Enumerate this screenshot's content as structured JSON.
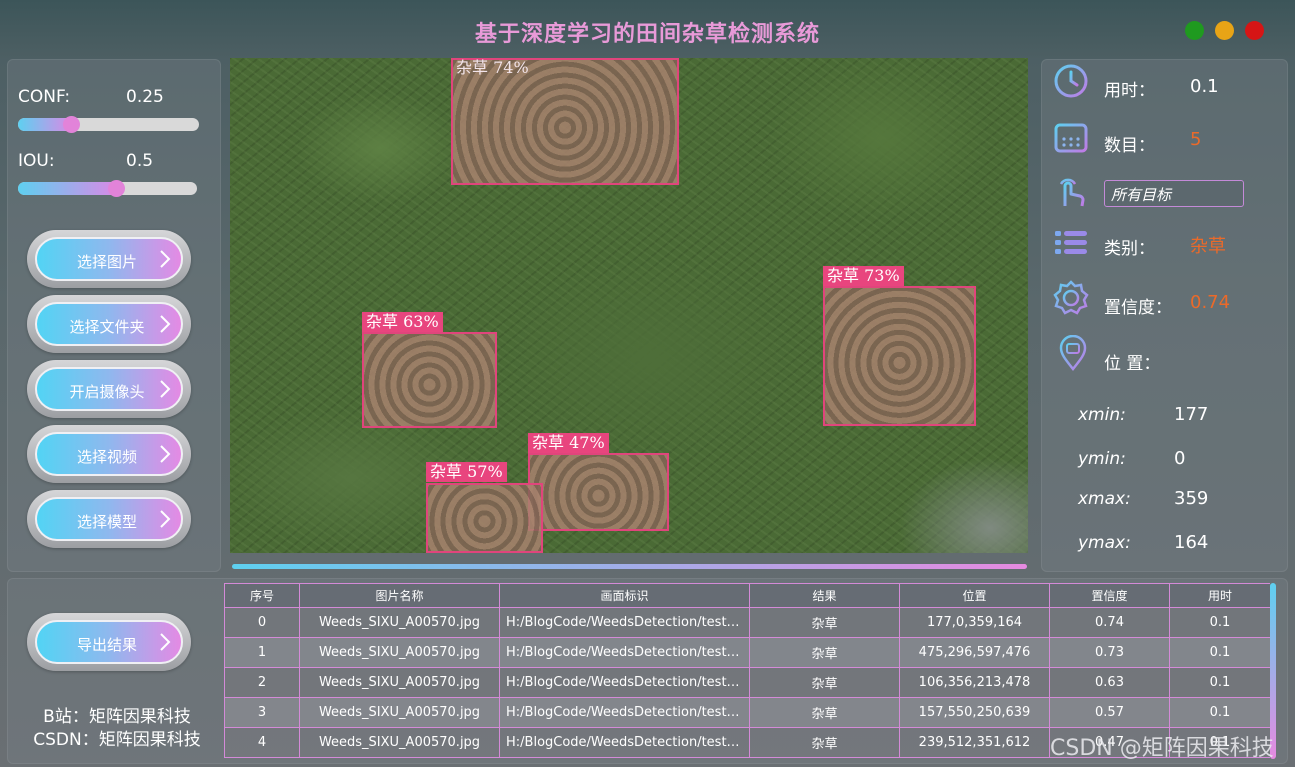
{
  "window": {
    "title": "基于深度学习的田间杂草检测系统"
  },
  "params": {
    "conf_label": "CONF:",
    "conf_value": "0.25",
    "conf_level": 0.25,
    "iou_label": "IOU:",
    "iou_value": "0.5",
    "iou_level": 0.5
  },
  "buttons": {
    "select_image": "选择图片",
    "select_folder": "选择文件夹",
    "open_camera": "开启摄像头",
    "select_video": "选择视频",
    "select_model": "选择模型",
    "export": "导出结果"
  },
  "credits": {
    "bilibili": "B站：矩阵因果科技",
    "csdn": "CSDN：矩阵因果科技"
  },
  "detections": [
    {
      "label": "杂草  74%"
    },
    {
      "label": "杂草  73%"
    },
    {
      "label": "杂草  63%"
    },
    {
      "label": "杂草  47%"
    },
    {
      "label": "杂草  57%"
    }
  ],
  "info": {
    "time_label": "用时：",
    "time_value": "0.1",
    "count_label": "数目：",
    "count_value": "5",
    "target_select": "所有目标",
    "class_label": "类别：",
    "class_value": "杂草",
    "conf_label": "置信度：",
    "conf_value": "0.74",
    "position_label": "位 置：",
    "xmin_label": "xmin:",
    "xmin_value": "177",
    "ymin_label": "ymin:",
    "ymin_value": "0",
    "xmax_label": "xmax:",
    "xmax_value": "359",
    "ymax_label": "ymax:",
    "ymax_value": "164"
  },
  "table": {
    "headers": [
      "序号",
      "图片名称",
      "画面标识",
      "结果",
      "位置",
      "置信度",
      "用时"
    ],
    "rows": [
      [
        "0",
        "Weeds_SIXU_A00570.jpg",
        "H:/BlogCode/WeedsDetection/test_...",
        "杂草",
        "177,0,359,164",
        "0.74",
        "0.1"
      ],
      [
        "1",
        "Weeds_SIXU_A00570.jpg",
        "H:/BlogCode/WeedsDetection/test_...",
        "杂草",
        "475,296,597,476",
        "0.73",
        "0.1"
      ],
      [
        "2",
        "Weeds_SIXU_A00570.jpg",
        "H:/BlogCode/WeedsDetection/test_...",
        "杂草",
        "106,356,213,478",
        "0.63",
        "0.1"
      ],
      [
        "3",
        "Weeds_SIXU_A00570.jpg",
        "H:/BlogCode/WeedsDetection/test_...",
        "杂草",
        "157,550,250,639",
        "0.57",
        "0.1"
      ],
      [
        "4",
        "Weeds_SIXU_A00570.jpg",
        "H:/BlogCode/WeedsDetection/test_...",
        "杂草",
        "239,512,351,612",
        "0.47",
        "0.1"
      ]
    ]
  },
  "watermark": "CSDN @矩阵因果科技",
  "colors": {
    "accent": "#ea6a2a",
    "title": "#e89ad8",
    "box": "#e0457c",
    "win_green": "#1f9a1f",
    "win_yellow": "#e8a416",
    "win_red": "#d61515"
  }
}
